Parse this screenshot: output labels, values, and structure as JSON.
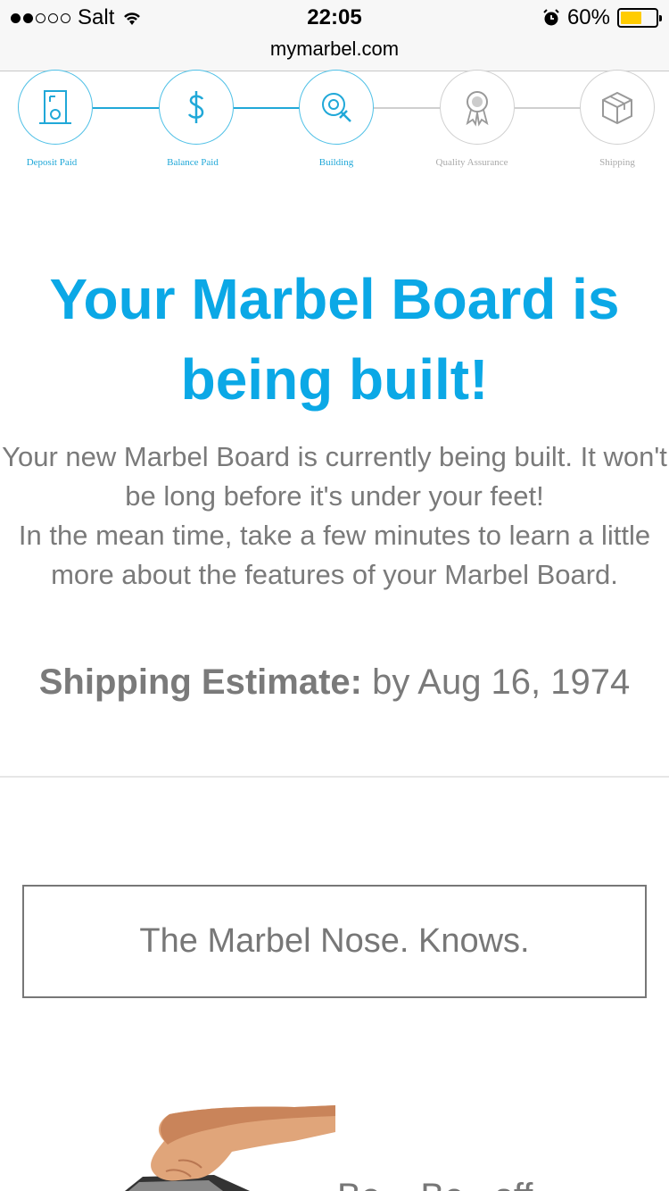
{
  "status_bar": {
    "carrier": "Salt",
    "time": "22:05",
    "battery_pct": "60%",
    "battery_level": 0.6,
    "signal_dots": [
      true,
      true,
      false,
      false,
      false
    ]
  },
  "url_bar": {
    "url": "mymarbel.com"
  },
  "progress": {
    "steps": [
      {
        "label": "Deposit Paid",
        "icon": "door-icon",
        "complete": true
      },
      {
        "label": "Balance Paid",
        "icon": "dollar-icon",
        "complete": true
      },
      {
        "label": "Building",
        "icon": "gear-wrench-icon",
        "complete": true
      },
      {
        "label": "Quality Assurance",
        "icon": "award-ribbon-icon",
        "complete": false
      },
      {
        "label": "Shipping",
        "icon": "package-box-icon",
        "complete": false
      }
    ]
  },
  "headline": "Your Marbel Board is being built!",
  "intro": "Your new Marbel Board is currently being built. It won't be long before it's under your feet!\nIn the mean time, take a few minutes to learn a little more about the features of your Marbel Board.",
  "shipping": {
    "label": "Shipping Estimate:",
    "value": "by Aug 16, 1974"
  },
  "cta": {
    "label": "The Marbel Nose. Knows."
  },
  "bottom_text": "Be... Be...off",
  "colors": {
    "accent": "#0ba8e6",
    "text": "#777777",
    "battery": "#ffcc00"
  }
}
